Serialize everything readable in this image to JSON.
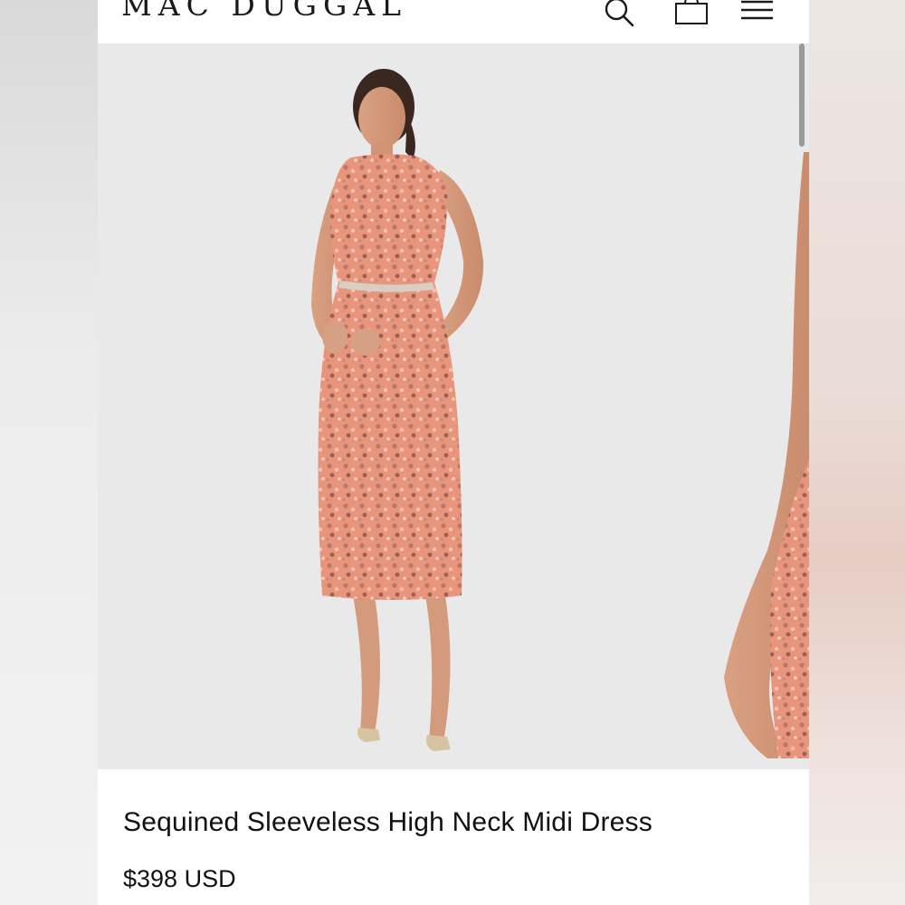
{
  "header": {
    "brand": "MAC DUGGAL",
    "icons": [
      "search-icon",
      "shopping-bag-icon",
      "menu-icon"
    ]
  },
  "gallery": {
    "background_color": "#e9e9ea",
    "dress_color": "#e89a82"
  },
  "product": {
    "title": "Sequined Sleeveless High Neck Midi Dress",
    "price": "$398 USD"
  },
  "colors": {
    "text": "#111111",
    "header_bg": "#ffffff"
  }
}
